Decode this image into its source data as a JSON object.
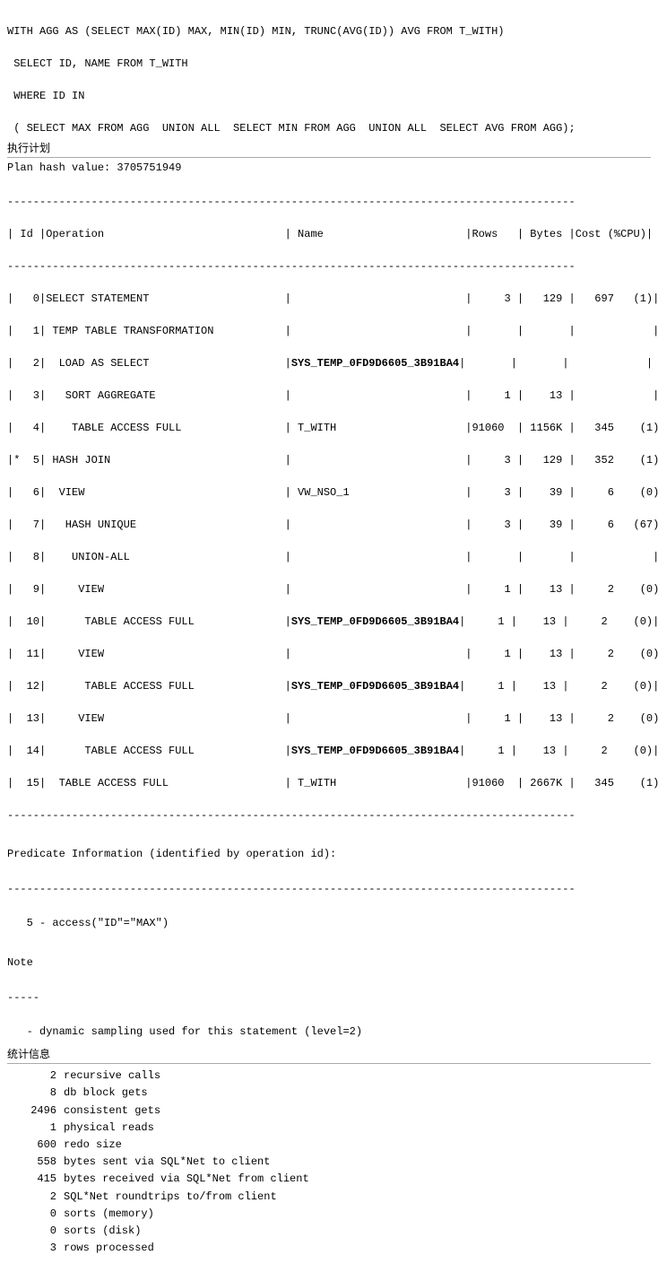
{
  "sql": {
    "line1": "WITH AGG AS (SELECT MAX(ID) MAX, MIN(ID) MIN, TRUNC(AVG(ID)) AVG FROM T_WITH)",
    "line2": " SELECT ID, NAME FROM T_WITH",
    "line3": " WHERE ID IN",
    "line4": " ( SELECT MAX FROM AGG  UNION ALL  SELECT MIN FROM AGG  UNION ALL  SELECT AVG FROM AGG);"
  },
  "section_labels": {
    "execution_plan": "执行计划",
    "stats": "统计信息"
  },
  "plan": {
    "hash_label": "Plan hash value: 3705751949",
    "divider_char": "-",
    "header": {
      "id": " Id ",
      "operation": "Operation",
      "name": "Name",
      "rows": "Rows",
      "bytes": "Bytes",
      "cost": "Cost (%CPU)"
    },
    "rows": [
      {
        "id": "  0",
        "marker": " ",
        "operation": "SELECT STATEMENT",
        "name": "",
        "rows": "3",
        "bytes": "129",
        "cost": "697    (1)"
      },
      {
        "id": "  1",
        "marker": " ",
        "operation": " TEMP TABLE TRANSFORMATION",
        "name": "",
        "rows": "",
        "bytes": "",
        "cost": ""
      },
      {
        "id": "  2",
        "marker": " ",
        "operation": "  LOAD AS SELECT",
        "name": "SYS_TEMP_0FD9D6605_3B91BA4",
        "rows": "",
        "bytes": "",
        "cost": "",
        "bold_name": true
      },
      {
        "id": "  3",
        "marker": " ",
        "operation": "   SORT AGGREGATE",
        "name": "",
        "rows": "1",
        "bytes": "13",
        "cost": ""
      },
      {
        "id": "  4",
        "marker": " ",
        "operation": "    TABLE ACCESS FULL",
        "name": "T_WITH",
        "rows": "91060",
        "bytes": "1156K",
        "cost": "345     (1)"
      },
      {
        "id": "* 5",
        "marker": "*",
        "operation": " HASH JOIN",
        "name": "",
        "rows": "3",
        "bytes": "129",
        "cost": "352     (1)"
      },
      {
        "id": "  6",
        "marker": " ",
        "operation": "  VIEW",
        "name": "VW_NSO_1",
        "rows": "3",
        "bytes": "39",
        "cost": "6      (0)"
      },
      {
        "id": "  7",
        "marker": " ",
        "operation": "   HASH UNIQUE",
        "name": "",
        "rows": "3",
        "bytes": "39",
        "cost": "6    (67)"
      },
      {
        "id": "  8",
        "marker": " ",
        "operation": "    UNION-ALL",
        "name": "",
        "rows": "",
        "bytes": "",
        "cost": ""
      },
      {
        "id": "  9",
        "marker": " ",
        "operation": "     VIEW",
        "name": "",
        "rows": "1",
        "bytes": "13",
        "cost": "2      (0)"
      },
      {
        "id": " 10",
        "marker": " ",
        "operation": "      TABLE ACCESS FULL",
        "name": "SYS_TEMP_0FD9D6605_3B91BA4",
        "rows": "1",
        "bytes": "13",
        "cost": "2      (0)",
        "bold_name": true
      },
      {
        "id": " 11",
        "marker": " ",
        "operation": "     VIEW",
        "name": "",
        "rows": "1",
        "bytes": "13",
        "cost": "2      (0)"
      },
      {
        "id": " 12",
        "marker": " ",
        "operation": "      TABLE ACCESS FULL",
        "name": "SYS_TEMP_0FD9D6605_3B91BA4",
        "rows": "1",
        "bytes": "13",
        "cost": "2      (0)",
        "bold_name": true
      },
      {
        "id": " 13",
        "marker": " ",
        "operation": "     VIEW",
        "name": "",
        "rows": "1",
        "bytes": "13",
        "cost": "2      (0)"
      },
      {
        "id": " 14",
        "marker": " ",
        "operation": "      TABLE ACCESS FULL",
        "name": "SYS_TEMP_0FD9D6605_3B91BA4",
        "rows": "1",
        "bytes": "13",
        "cost": "2      (0)",
        "bold_name": true
      },
      {
        "id": " 15",
        "marker": " ",
        "operation": "  TABLE ACCESS FULL",
        "name": "T_WITH",
        "rows": "91060",
        "bytes": "2667K",
        "cost": "345     (1)"
      }
    ]
  },
  "predicate": {
    "title": "Predicate Information (identified by operation id):",
    "items": [
      "   5 - access(\"ID\"=\"MAX\")"
    ]
  },
  "note": {
    "title": "Note",
    "divider": "-----",
    "items": [
      "   - dynamic sampling used for this statement (level=2)"
    ]
  },
  "statistics": {
    "items": [
      {
        "num": "2",
        "label": "recursive calls"
      },
      {
        "num": "8",
        "label": "db block gets"
      },
      {
        "num": "2496",
        "label": "consistent gets"
      },
      {
        "num": "1",
        "label": "physical reads"
      },
      {
        "num": "600",
        "label": "redo size"
      },
      {
        "num": "558",
        "label": "bytes sent via SQL*Net to client"
      },
      {
        "num": "415",
        "label": "bytes received via SQL*Net from client"
      },
      {
        "num": "2",
        "label": "SQL*Net roundtrips to/from client"
      },
      {
        "num": "0",
        "label": "sorts (memory)"
      },
      {
        "num": "0",
        "label": "sorts (disk)"
      },
      {
        "num": "3",
        "label": "rows processed"
      }
    ]
  }
}
